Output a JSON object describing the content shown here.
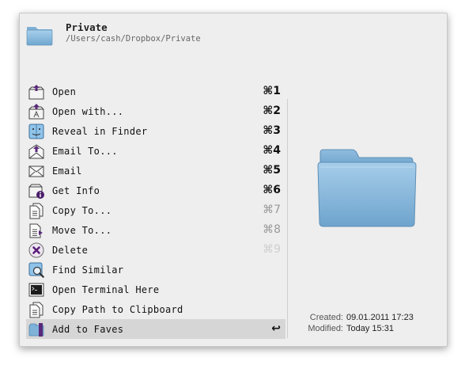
{
  "header": {
    "title": "Private",
    "path": "/Users/cash/Dropbox/Private",
    "icon": "folder-icon"
  },
  "menu": {
    "items": [
      {
        "label": "Open",
        "shortcut": "⌘1",
        "icon": "open-icon"
      },
      {
        "label": "Open with...",
        "shortcut": "⌘2",
        "icon": "open-with-icon"
      },
      {
        "label": "Reveal in Finder",
        "shortcut": "⌘3",
        "icon": "finder-icon"
      },
      {
        "label": "Email To...",
        "shortcut": "⌘4",
        "icon": "email-to-icon"
      },
      {
        "label": "Email",
        "shortcut": "⌘5",
        "icon": "envelope-icon"
      },
      {
        "label": "Get Info",
        "shortcut": "⌘6",
        "icon": "info-icon"
      },
      {
        "label": "Copy To...",
        "shortcut": "⌘7",
        "icon": "copy-document-icon"
      },
      {
        "label": "Move To...",
        "shortcut": "⌘8",
        "icon": "move-document-icon"
      },
      {
        "label": "Delete",
        "shortcut": "⌘9",
        "icon": "delete-icon"
      },
      {
        "label": "Find Similar",
        "shortcut": "",
        "icon": "find-similar-icon"
      },
      {
        "label": "Open Terminal Here",
        "shortcut": "",
        "icon": "terminal-icon"
      },
      {
        "label": "Copy Path to Clipboard",
        "shortcut": "",
        "icon": "clipboard-icon"
      },
      {
        "label": "Add to Faves",
        "shortcut": "↩",
        "icon": "faves-icon",
        "selected": true
      }
    ]
  },
  "meta": {
    "created_label": "Created:",
    "created_value": "09.01.2011 17:23",
    "modified_label": "Modified:",
    "modified_value": "Today 15:31"
  },
  "colors": {
    "panel_bg": "#eeeeee",
    "selected_bg": "#d6d6d6",
    "folder_blue": "#7fb2d8"
  }
}
